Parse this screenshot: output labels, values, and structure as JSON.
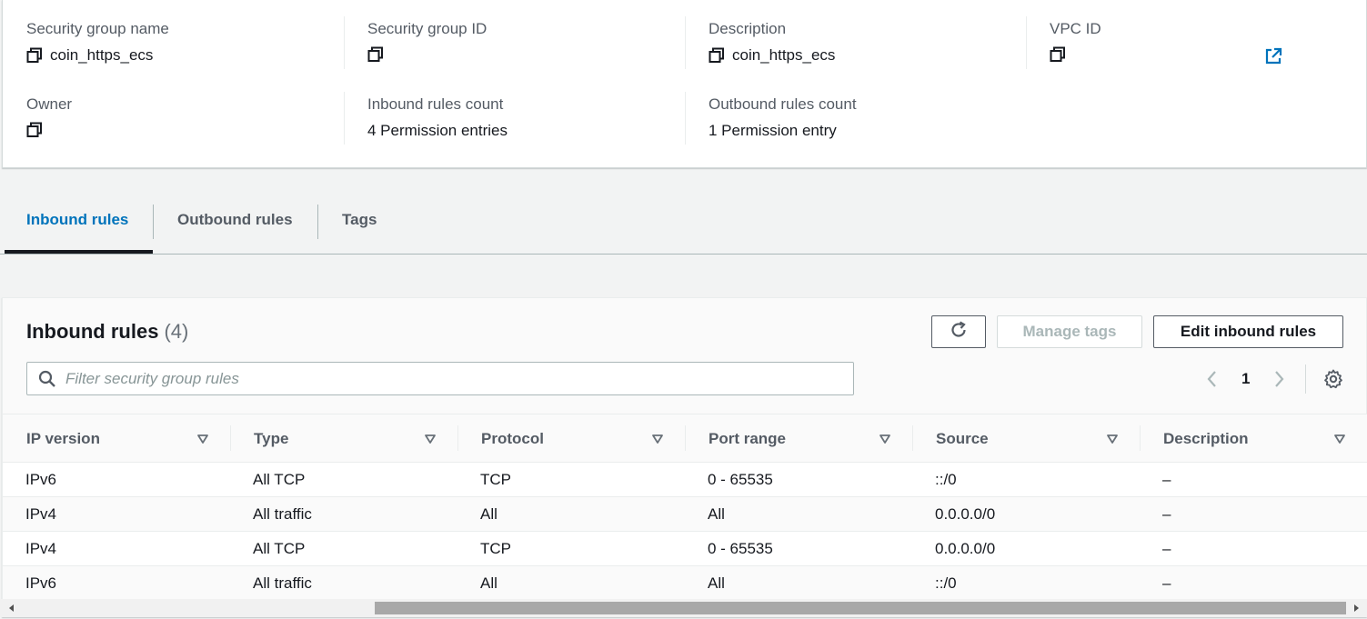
{
  "details": {
    "security_group_name": {
      "label": "Security group name",
      "value": "coin_https_ecs"
    },
    "security_group_id": {
      "label": "Security group ID",
      "value": ""
    },
    "description": {
      "label": "Description",
      "value": "coin_https_ecs"
    },
    "vpc_id": {
      "label": "VPC ID",
      "value": ""
    },
    "owner": {
      "label": "Owner",
      "value": ""
    },
    "inbound_rules_count": {
      "label": "Inbound rules count",
      "value": "4 Permission entries"
    },
    "outbound_rules_count": {
      "label": "Outbound rules count",
      "value": "1 Permission entry"
    }
  },
  "tabs": [
    {
      "label": "Inbound rules",
      "active": true
    },
    {
      "label": "Outbound rules",
      "active": false
    },
    {
      "label": "Tags",
      "active": false
    }
  ],
  "panel": {
    "title": "Inbound rules",
    "count": "(4)",
    "manage_tags_label": "Manage tags",
    "edit_rules_label": "Edit inbound rules",
    "filter_placeholder": "Filter security group rules",
    "filter_value": "",
    "page": "1"
  },
  "table": {
    "columns": [
      "IP version",
      "Type",
      "Protocol",
      "Port range",
      "Source",
      "Description"
    ],
    "rows": [
      [
        "IPv6",
        "All TCP",
        "TCP",
        "0 - 65535",
        "::/0",
        "–"
      ],
      [
        "IPv4",
        "All traffic",
        "All",
        "All",
        "0.0.0.0/0",
        "–"
      ],
      [
        "IPv4",
        "All TCP",
        "TCP",
        "0 - 65535",
        "0.0.0.0/0",
        "–"
      ],
      [
        "IPv6",
        "All traffic",
        "All",
        "All",
        "::/0",
        "–"
      ]
    ]
  },
  "icons": {
    "copy": "copy-icon",
    "external_link": "external-link-icon",
    "refresh": "refresh-icon",
    "search": "search-icon",
    "chevron_left": "chevron-left-icon",
    "chevron_right": "chevron-right-icon",
    "settings": "gear-icon",
    "sort": "sort-caret-down-icon"
  },
  "colors": {
    "accent": "#0073bb",
    "text": "#16191f",
    "secondary_text": "#545b64",
    "background": "#f2f3f3"
  }
}
